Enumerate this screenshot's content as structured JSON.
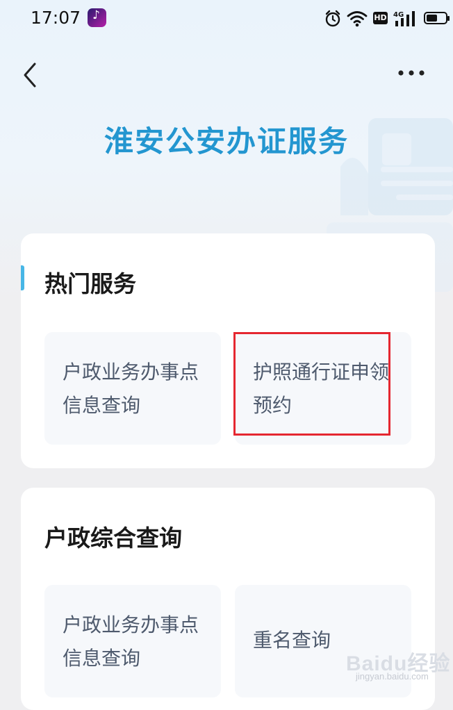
{
  "status_bar": {
    "time": "17:07",
    "network": "4G",
    "hd_label": "HD",
    "app_icon": "douyin-music-note-icon"
  },
  "nav": {
    "back_icon": "chevron-left-icon",
    "more_icon": "more-horizontal-icon"
  },
  "page_title": "淮安公安办证服务",
  "sections": {
    "hot": {
      "title": "热门服务",
      "items": [
        {
          "label": "户政业务办事点信息查询"
        },
        {
          "label": "护照通行证申领预约"
        }
      ]
    },
    "household": {
      "title": "户政综合查询",
      "items": [
        {
          "label": "户政业务办事点信息查询"
        },
        {
          "label": "重名查询"
        }
      ]
    }
  },
  "watermark": {
    "logo": "Baidu经验",
    "url": "jingyan.baidu.com"
  },
  "colors": {
    "accent": "#2396d0",
    "section_bar": "#47b6e6",
    "highlight": "#e52730"
  }
}
